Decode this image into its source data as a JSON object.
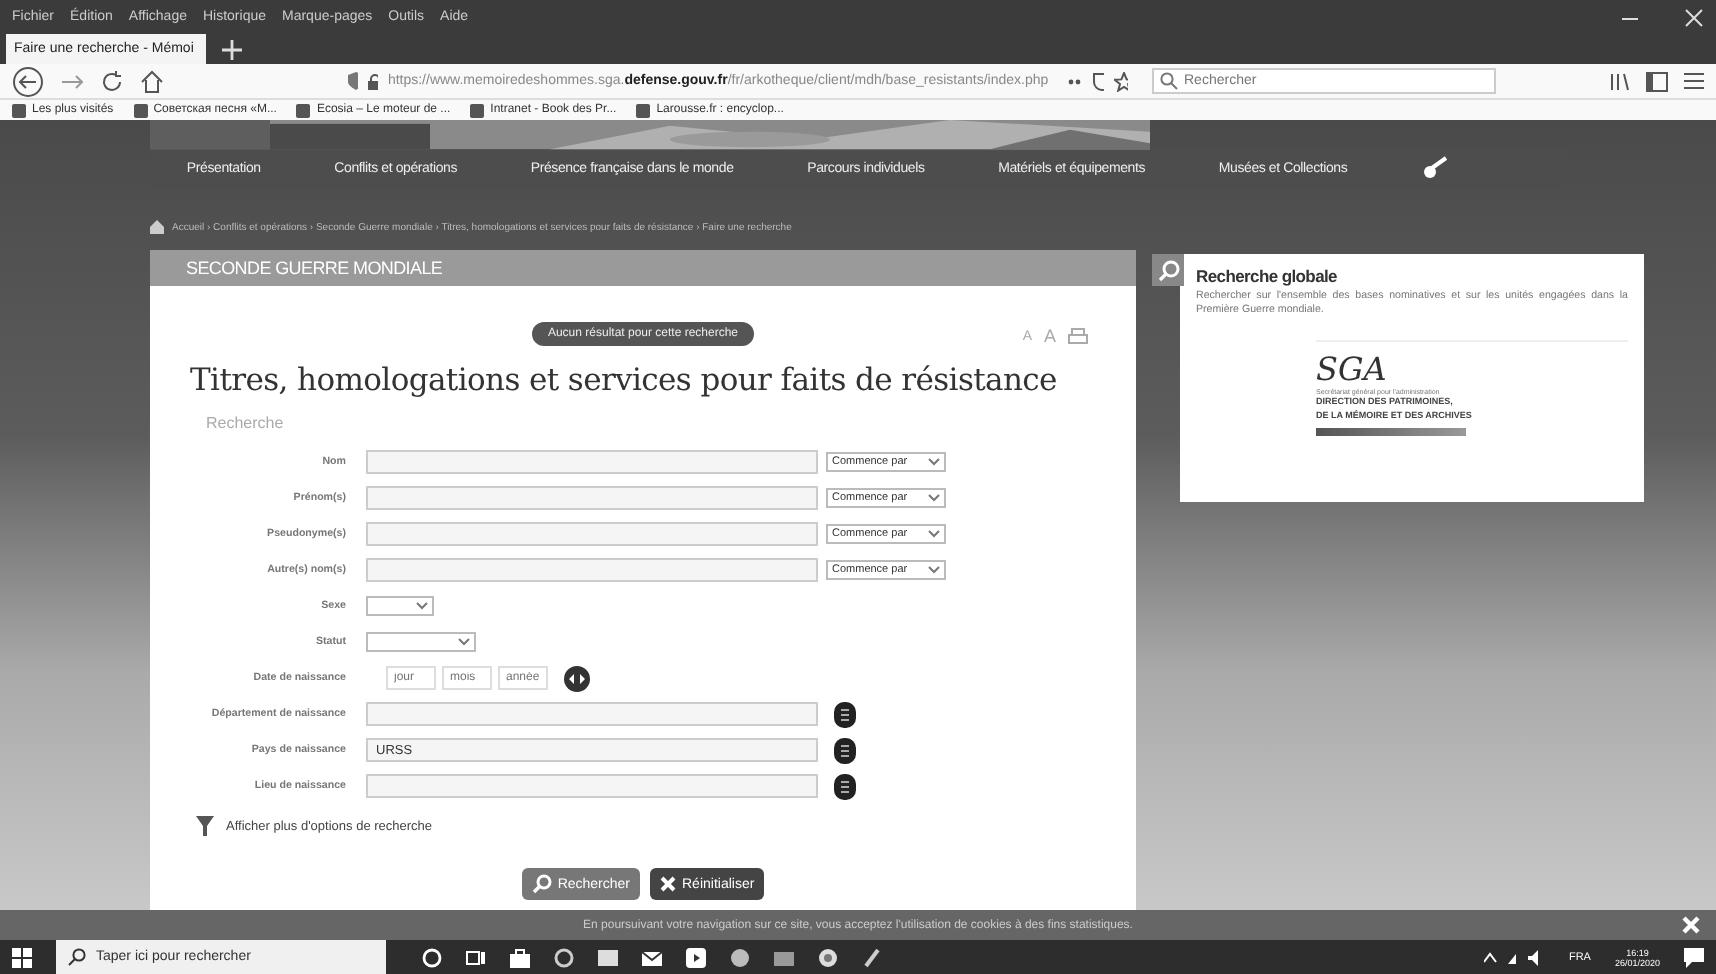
{
  "browser": {
    "menu": [
      "Fichier",
      "Édition",
      "Affichage",
      "Historique",
      "Marque-pages",
      "Outils",
      "Aide"
    ],
    "tabs": [
      {
        "label": "Faire une recherche - Mémoi",
        "selected": true
      }
    ],
    "url_host": "https://www.memoiredeshommes.sga.",
    "url_domain": "defense.gouv.fr",
    "url_path": "/fr/arkotheque/client/mdh/base_resistants/index.php",
    "search": {
      "placeholder": "Rechercher"
    },
    "bookmarks": [
      "Les plus visités",
      "Советская песня «М...",
      "Ecosia – Le moteur de ...",
      "Intranet - Book des Pr...",
      "Larousse.fr : encyclop..."
    ]
  },
  "nav": [
    "Présentation",
    "Conflits et opérations",
    "Présence française dans le monde",
    "Parcours individuels",
    "Matériels et équipements",
    "Musées et Collections"
  ],
  "breadcrumb": "Accueil › Conflits et opérations › Seconde Guerre mondiale › Titres, homologations et services pour faits de résistance › Faire une recherche",
  "section": "SECONDE GUERRE MONDIALE",
  "notice": "Aucun résultat pour cette recherche",
  "text_size": [
    "A",
    "A"
  ],
  "title": "Titres, homologations et services pour faits de résistance",
  "legend": "Recherche",
  "fields": [
    {
      "label": "Nom",
      "kind": "match",
      "match": "Commence par"
    },
    {
      "label": "Prénom(s)",
      "kind": "match",
      "match": "Commence par"
    },
    {
      "label": "Pseudonyme(s)",
      "kind": "match",
      "match": "Commence par"
    },
    {
      "label": "Autre(s) nom(s)",
      "kind": "match",
      "match": "Commence par"
    },
    {
      "label": "Sexe",
      "kind": "short_select"
    },
    {
      "label": "Statut",
      "kind": "select"
    },
    {
      "label": "Date de naissance",
      "kind": "date",
      "placeholders": [
        "jour",
        "mois",
        "année"
      ]
    },
    {
      "label": "Département de naissance",
      "kind": "lookup"
    },
    {
      "label": "Pays de naissance",
      "kind": "lookup",
      "value": "URSS"
    },
    {
      "label": "Lieu de naissance",
      "kind": "lookup"
    }
  ],
  "more_options": "Afficher plus d'options de recherche",
  "buttons": [
    {
      "label": "Rechercher",
      "kind": "search"
    },
    {
      "label": "Réinitialiser",
      "kind": "reset"
    }
  ],
  "side": {
    "title": "Recherche globale",
    "text": "Rechercher sur l'ensemble des bases nominatives et sur les unités engagées dans la Première Guerre mondiale.",
    "logo": "SGA",
    "logo_sub": "Secrétariat général pour l'administration",
    "dir_lines": [
      "DIRECTION DES PATRIMOINES,",
      "DE LA MÉMOIRE ET DES ARCHIVES"
    ]
  },
  "cookie": "En poursuivant votre navigation sur ce site, vous acceptez l'utilisation de cookies à des fins statistiques.",
  "taskbar": {
    "search": "Taper ici pour rechercher",
    "lang": "FRA",
    "time": "16:19",
    "date": "26/01/2020"
  }
}
